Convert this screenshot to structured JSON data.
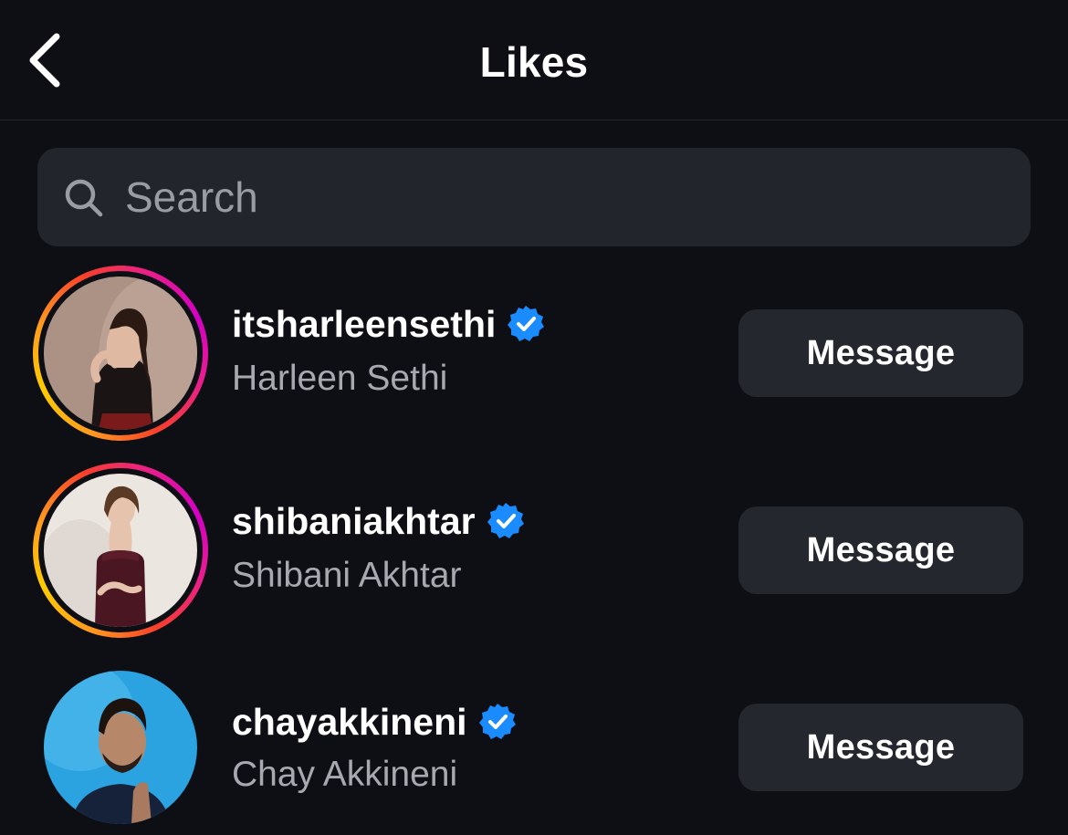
{
  "header": {
    "title": "Likes",
    "back_icon": "chevron-left-icon"
  },
  "search": {
    "placeholder": "Search",
    "value": "",
    "icon": "search-icon"
  },
  "users": [
    {
      "username": "itsharleensethi",
      "full_name": "Harleen Sethi",
      "verified": true,
      "has_story_ring": true,
      "button_label": "Message"
    },
    {
      "username": "shibaniakhtar",
      "full_name": "Shibani Akhtar",
      "verified": true,
      "has_story_ring": true,
      "button_label": "Message"
    },
    {
      "username": "chayakkineni",
      "full_name": "Chay Akkineni",
      "verified": true,
      "has_story_ring": false,
      "button_label": "Message"
    }
  ],
  "colors": {
    "background": "#0d0f14",
    "search_bg": "#23252c",
    "button_bg": "#25272e",
    "verified_blue": "#1a8cff",
    "secondary_text": "#a7a9b0"
  }
}
